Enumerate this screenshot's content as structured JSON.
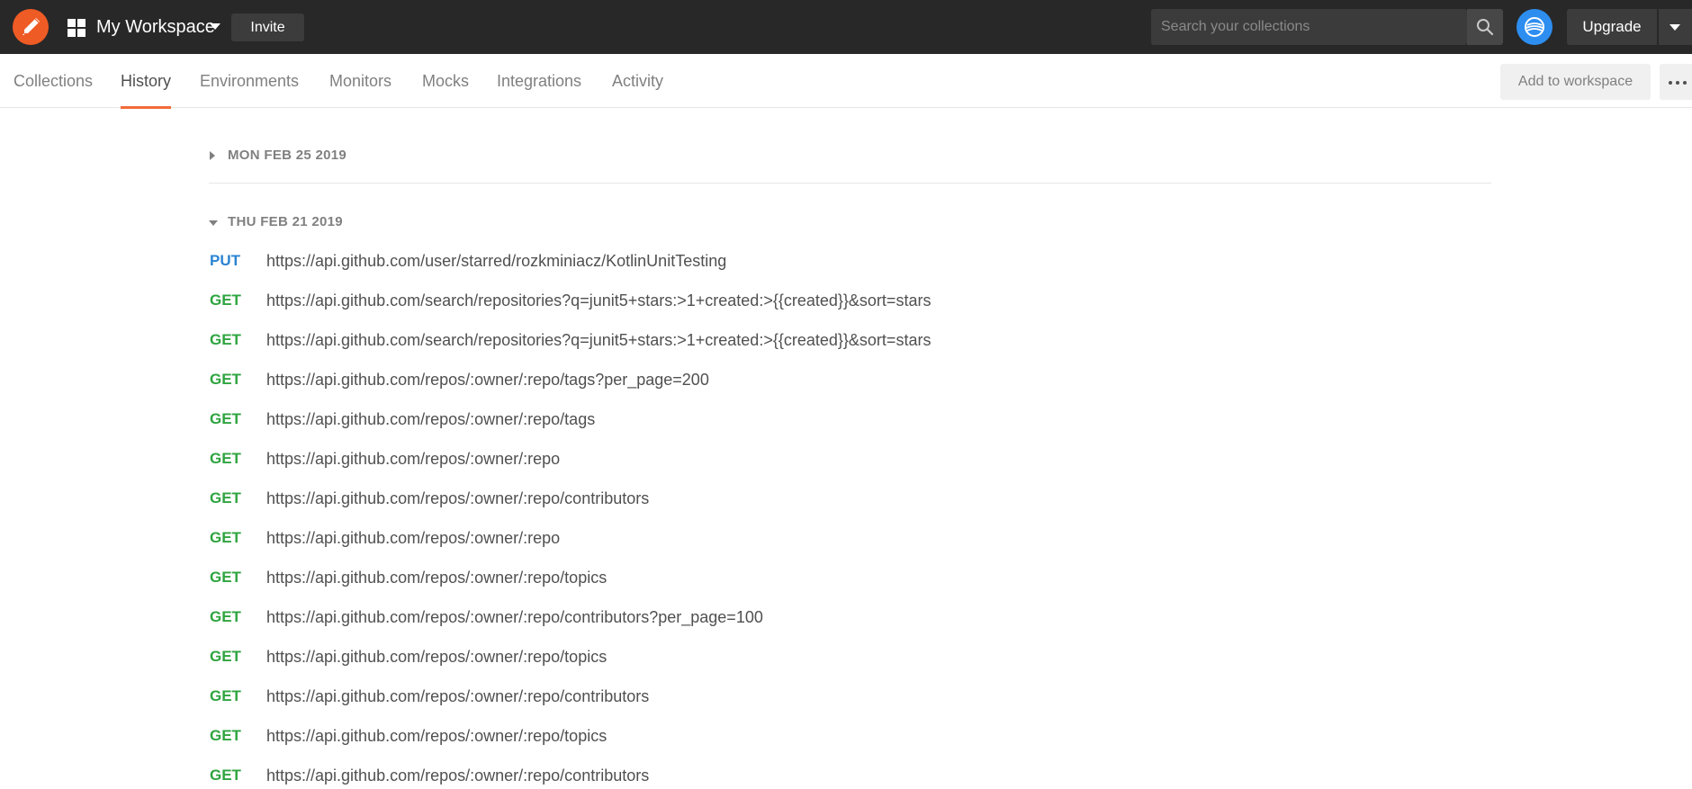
{
  "header": {
    "workspace_name": "My Workspace",
    "invite_label": "Invite",
    "search_placeholder": "Search your collections",
    "upgrade_label": "Upgrade",
    "brand_color": "#ef5b25"
  },
  "tabs": [
    {
      "label": "Collections"
    },
    {
      "label": "History",
      "active": true
    },
    {
      "label": "Environments"
    },
    {
      "label": "Monitors"
    },
    {
      "label": "Mocks"
    },
    {
      "label": "Integrations"
    },
    {
      "label": "Activity"
    }
  ],
  "toolbar": {
    "add_to_workspace_label": "Add to workspace"
  },
  "history": {
    "groups": [
      {
        "date": "MON FEB 25 2019",
        "expanded": false
      },
      {
        "date": "THU FEB 21 2019",
        "expanded": true
      }
    ],
    "requests": [
      {
        "method": "PUT",
        "url": "https://api.github.com/user/starred/rozkminiacz/KotlinUnitTesting"
      },
      {
        "method": "GET",
        "url": "https://api.github.com/search/repositories?q=junit5+stars:>1+created:>{{created}}&sort=stars"
      },
      {
        "method": "GET",
        "url": "https://api.github.com/search/repositories?q=junit5+stars:>1+created:>{{created}}&sort=stars"
      },
      {
        "method": "GET",
        "url": "https://api.github.com/repos/:owner/:repo/tags?per_page=200"
      },
      {
        "method": "GET",
        "url": "https://api.github.com/repos/:owner/:repo/tags"
      },
      {
        "method": "GET",
        "url": "https://api.github.com/repos/:owner/:repo"
      },
      {
        "method": "GET",
        "url": "https://api.github.com/repos/:owner/:repo/contributors"
      },
      {
        "method": "GET",
        "url": "https://api.github.com/repos/:owner/:repo"
      },
      {
        "method": "GET",
        "url": "https://api.github.com/repos/:owner/:repo/topics"
      },
      {
        "method": "GET",
        "url": "https://api.github.com/repos/:owner/:repo/contributors?per_page=100"
      },
      {
        "method": "GET",
        "url": "https://api.github.com/repos/:owner/:repo/topics"
      },
      {
        "method": "GET",
        "url": "https://api.github.com/repos/:owner/:repo/contributors"
      },
      {
        "method": "GET",
        "url": "https://api.github.com/repos/:owner/:repo/topics"
      },
      {
        "method": "GET",
        "url": "https://api.github.com/repos/:owner/:repo/contributors"
      }
    ],
    "method_colors": {
      "GET": "#2ea43f",
      "PUT": "#2a84d2"
    }
  },
  "icons": {
    "logo": "postman-logo-icon",
    "workspace": "grid-icon",
    "search": "search-icon",
    "sync": "sync-status-icon",
    "more": "more-options-icon"
  }
}
